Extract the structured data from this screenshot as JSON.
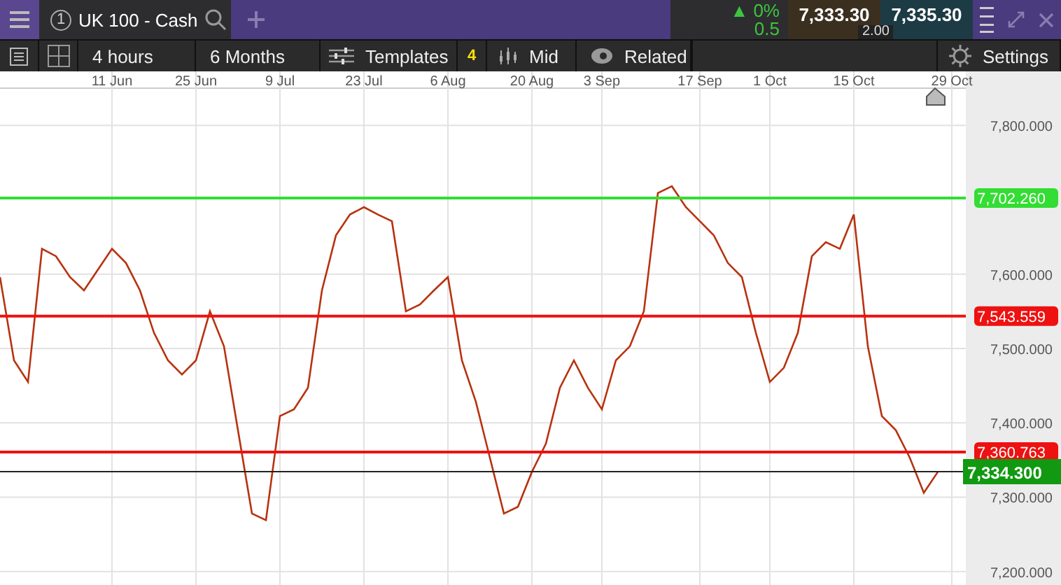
{
  "title_bar": {
    "tab": {
      "number": "1",
      "label": "UK 100 - Cash"
    },
    "change_arrow": "▲",
    "change": "0%",
    "change_points": "0.5",
    "sell": "7,333.30",
    "buy": "7,335.30",
    "spread": "2.00"
  },
  "toolbar": {
    "interval": "4 hours",
    "range": "6 Months",
    "templates": "Templates",
    "templates_count": "4",
    "price_type": "Mid",
    "related": "Related",
    "settings": "Settings"
  },
  "chart": {
    "chart_data": {
      "type": "line",
      "grid": true,
      "ylim": [
        7180,
        7850
      ],
      "categories": [
        null,
        null,
        null,
        null,
        null,
        null,
        null,
        null,
        "11 Jun",
        null,
        null,
        null,
        null,
        null,
        "25 Jun",
        null,
        null,
        null,
        null,
        null,
        "9 Jul",
        null,
        null,
        null,
        null,
        null,
        "23 Jul",
        null,
        null,
        null,
        null,
        null,
        "6 Aug",
        null,
        null,
        null,
        null,
        null,
        "20 Aug",
        null,
        null,
        null,
        null,
        "3 Sep",
        null,
        null,
        null,
        null,
        null,
        null,
        "17 Sep",
        null,
        null,
        null,
        null,
        "1 Oct",
        null,
        null,
        null,
        null,
        null,
        "15 Oct",
        null,
        null,
        null,
        null,
        null,
        null,
        "29 Oct"
      ],
      "yticks": [
        {
          "value": 7800,
          "label": "7,800.000"
        },
        {
          "value": 7600,
          "label": "7,600.000"
        },
        {
          "value": 7500,
          "label": "7,500.000"
        },
        {
          "value": 7400,
          "label": "7,400.000"
        },
        {
          "value": 7300,
          "label": "7,300.000"
        },
        {
          "value": 7200,
          "label": "7,200.000"
        }
      ],
      "series": [
        {
          "color": "#b8320f",
          "values": [
            7596,
            7484,
            7455,
            7634,
            7624,
            7596,
            7578,
            7606,
            7634,
            7615,
            7578,
            7521,
            7484,
            7465,
            7484,
            7550,
            7503,
            7390,
            7278,
            7269,
            7409,
            7418,
            7447,
            7578,
            7652,
            7680,
            7690,
            7680,
            7671,
            7550,
            7559,
            7578,
            7596,
            7484,
            7428,
            7353,
            7278,
            7287,
            7334,
            7372,
            7447,
            7484,
            7447,
            7418,
            7484,
            7503,
            7550,
            7709,
            7718,
            7690,
            7671,
            7652,
            7615,
            7596,
            7521,
            7455,
            7474,
            7521,
            7624,
            7643,
            7634,
            7680,
            7503,
            7409,
            7390,
            7353,
            7306,
            7334,
            null
          ]
        }
      ],
      "ref_lines": [
        {
          "axis": "y",
          "value": 7702.26,
          "label": "7,702.260",
          "color": "#33dd33"
        },
        {
          "axis": "y",
          "value": 7543.559,
          "label": "7,543.559",
          "color": "#ee1111"
        },
        {
          "axis": "y",
          "value": 7360.763,
          "label": "7,360.763",
          "color": "#ee1111"
        },
        {
          "axis": "y",
          "value": 7334.3,
          "color": "#222222"
        }
      ]
    },
    "current_price": {
      "label": "7,334.300",
      "color": "#119911"
    }
  }
}
